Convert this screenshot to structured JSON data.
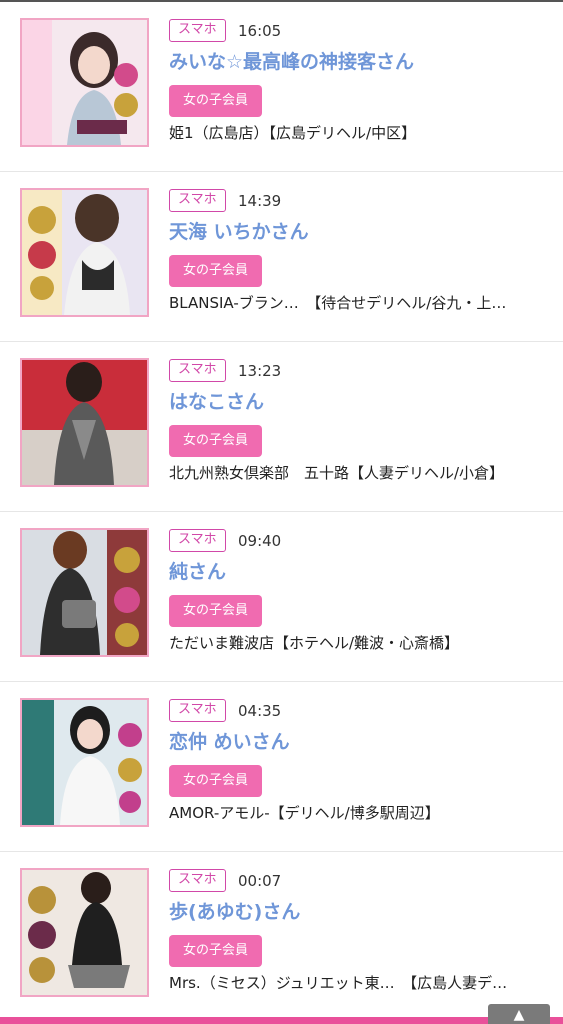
{
  "entries": [
    {
      "badge": "スマホ",
      "time": "16:05",
      "name": "みいな☆最高峰の神接客さん",
      "member": "女の子会員",
      "shop": "姫1（広島店）【広島デリヘル/中区】",
      "thumb": {
        "bg": "#f5e8ee",
        "accent": "#d24b8b"
      }
    },
    {
      "badge": "スマホ",
      "time": "14:39",
      "name": "天海 いちかさん",
      "member": "女の子会員",
      "shop": "BLANSIA-ブラン…　【待合せデリヘル/谷九・上…",
      "thumb": {
        "bg": "#e9e5f2",
        "accent": "#c8a23b"
      }
    },
    {
      "badge": "スマホ",
      "time": "13:23",
      "name": "はなこさん",
      "member": "女の子会員",
      "shop": "北九州熟女倶楽部　五十路【人妻デリヘル/小倉】",
      "thumb": {
        "bg": "#c92d3a",
        "accent": "#5a5a5a"
      }
    },
    {
      "badge": "スマホ",
      "time": "09:40",
      "name": "純さん",
      "member": "女の子会員",
      "shop": "ただいま難波店【ホテヘル/難波・心斎橋】",
      "thumb": {
        "bg": "#d9dde3",
        "accent": "#9a6a3a"
      }
    },
    {
      "badge": "スマホ",
      "time": "04:35",
      "name": "恋仲 めいさん",
      "member": "女の子会員",
      "shop": "AMOR-アモル-【デリヘル/博多駅周辺】",
      "thumb": {
        "bg": "#2f7a76",
        "accent": "#c23f8c"
      }
    },
    {
      "badge": "スマホ",
      "time": "00:07",
      "name": "歩(あゆむ)さん",
      "member": "女の子会員",
      "shop": "Mrs.（ミセス）ジュリエット東…　【広島人妻デ…",
      "thumb": {
        "bg": "#efe8e2",
        "accent": "#b8923a"
      }
    }
  ],
  "scroll_top": {
    "icon": "arrow-up-icon",
    "glyph": "▲"
  }
}
